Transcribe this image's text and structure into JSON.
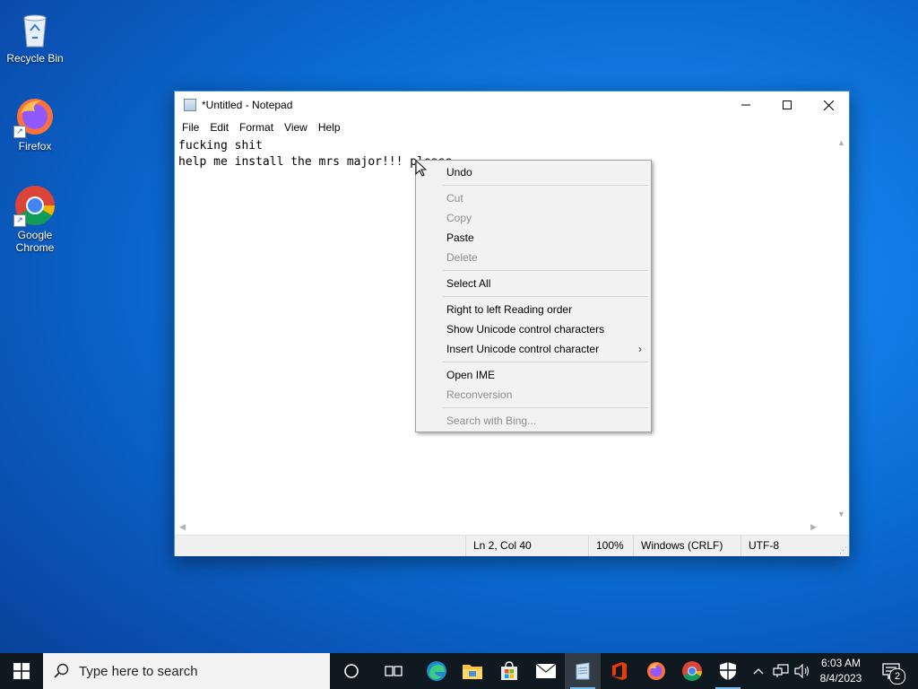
{
  "desktop": {
    "icons": [
      {
        "label": "Recycle Bin"
      },
      {
        "label": "Firefox"
      },
      {
        "label": "Google Chrome"
      }
    ]
  },
  "notepad": {
    "title": "*Untitled - Notepad",
    "menu": [
      "File",
      "Edit",
      "Format",
      "View",
      "Help"
    ],
    "content": "fucking shit\nhelp me install the mrs major!!! please",
    "status": {
      "position": "Ln 2, Col 40",
      "zoom": "100%",
      "line_ending": "Windows (CRLF)",
      "encoding": "UTF-8"
    }
  },
  "context_menu": {
    "items": [
      {
        "label": "Undo",
        "enabled": true
      },
      {
        "label": "Cut",
        "enabled": false
      },
      {
        "label": "Copy",
        "enabled": false
      },
      {
        "label": "Paste",
        "enabled": true
      },
      {
        "label": "Delete",
        "enabled": false
      },
      {
        "label": "Select All",
        "enabled": true
      },
      {
        "label": "Right to left Reading order",
        "enabled": true
      },
      {
        "label": "Show Unicode control characters",
        "enabled": true
      },
      {
        "label": "Insert Unicode control character",
        "enabled": true,
        "submenu": true
      },
      {
        "label": "Open IME",
        "enabled": true
      },
      {
        "label": "Reconversion",
        "enabled": false
      },
      {
        "label": "Search with Bing...",
        "enabled": false
      }
    ]
  },
  "taskbar": {
    "search_placeholder": "Type here to search",
    "pinned_apps": [
      "cortana-icon",
      "task-view-icon",
      "edge-icon",
      "file-explorer-icon",
      "store-icon",
      "mail-icon",
      "notepad-icon",
      "office-icon",
      "firefox-icon",
      "chrome-icon",
      "security-icon"
    ],
    "active_app": "notepad-icon",
    "clock": {
      "time": "6:03 AM",
      "date": "8/4/2023"
    },
    "notification_count": "2"
  }
}
